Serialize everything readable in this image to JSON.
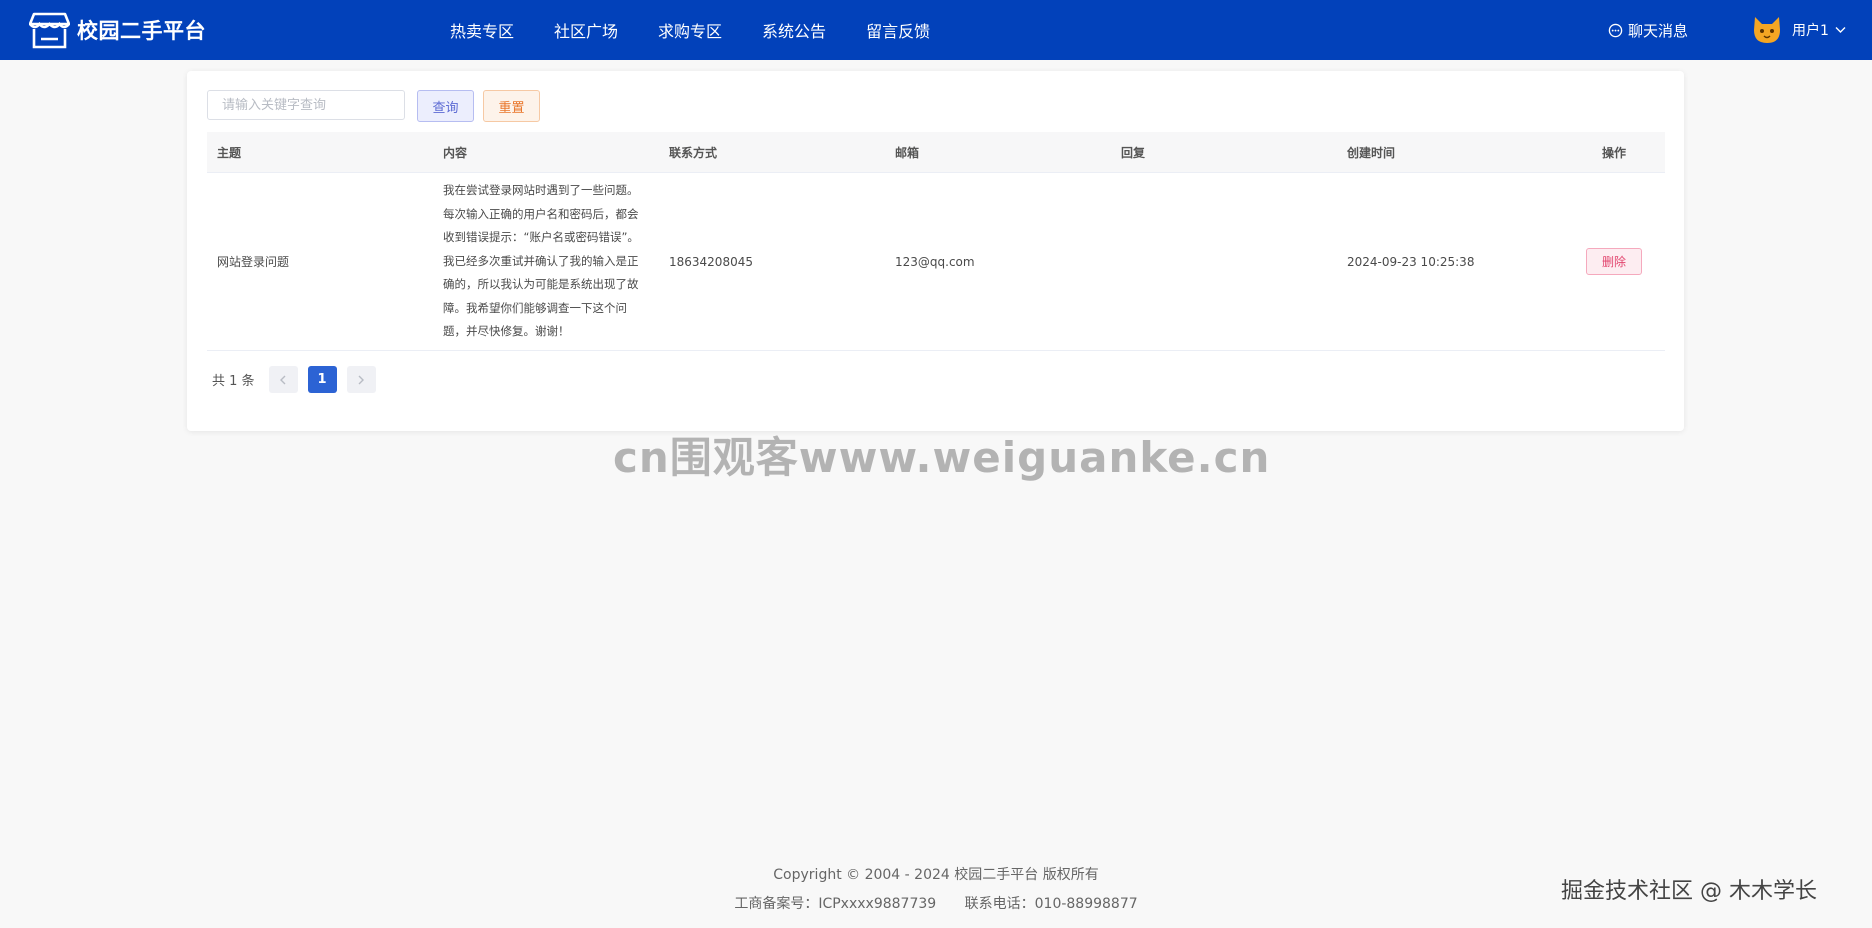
{
  "header": {
    "app_title": "校园二手平台",
    "nav": [
      "热卖专区",
      "社区广场",
      "求购专区",
      "系统公告",
      "留言反馈"
    ],
    "chat_label": "聊天消息",
    "user_label": "用户1",
    "bg_color": "#0241ba"
  },
  "toolbar": {
    "search_placeholder": "请输入关键字查询",
    "query_label": "查询",
    "reset_label": "重置"
  },
  "table": {
    "columns": [
      "主题",
      "内容",
      "联系方式",
      "邮箱",
      "回复",
      "创建时间",
      "操作"
    ],
    "rows": [
      {
        "subject": "网站登录问题",
        "content": "我在尝试登录网站时遇到了一些问题。每次输入正确的用户名和密码后，都会收到错误提示：“账户名或密码错误”。我已经多次重试并确认了我的输入是正确的，所以我认为可能是系统出现了故障。我希望你们能够调查一下这个问题，并尽快修复。谢谢！",
        "contact": "18634208045",
        "email": "123@qq.com",
        "reply": "",
        "created": "2024-09-23 10:25:38",
        "action": "删除"
      }
    ]
  },
  "pagination": {
    "total_text": "共 1 条",
    "current_page": "1"
  },
  "watermark": "cn围观客www.weiguanke.cn",
  "footer": {
    "copyright": "Copyright © 2004 - 2024 校园二手平台 版权所有",
    "icp": "工商备案号：ICPxxxx9887739",
    "phone": "联系电话：010-88998877"
  },
  "corner_watermark": "掘金技术社区 @ 木木学长"
}
